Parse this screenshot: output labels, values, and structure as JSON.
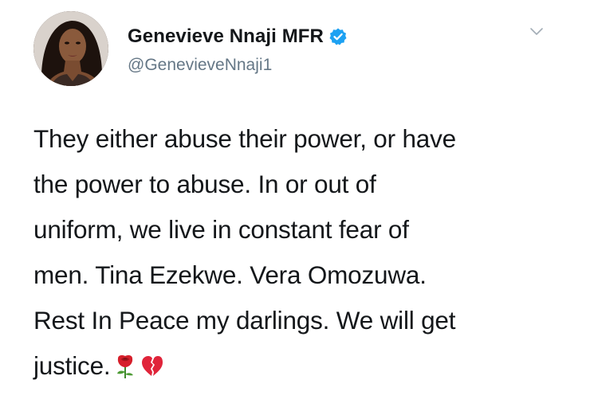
{
  "tweet": {
    "author": {
      "display_name": "Genevieve Nnaji MFR",
      "handle": "@GenevieveNnaji1",
      "verified": true,
      "verified_badge_color": "#1da1f2",
      "avatar_icon": "profile-avatar"
    },
    "menu_icon": "chevron-down-icon",
    "text_lines": [
      "They either abuse their power, or have",
      "the power to abuse. In or out of",
      "uniform, we live in constant fear of",
      "men. Tina Ezekwe. Vera Omozuwa.",
      "Rest In Peace my darlings. We will get",
      "justice."
    ],
    "emojis": [
      "rose-icon",
      "broken-heart-icon"
    ]
  },
  "colors": {
    "text": "#14171a",
    "secondary_text": "#657786",
    "background": "#ffffff"
  }
}
